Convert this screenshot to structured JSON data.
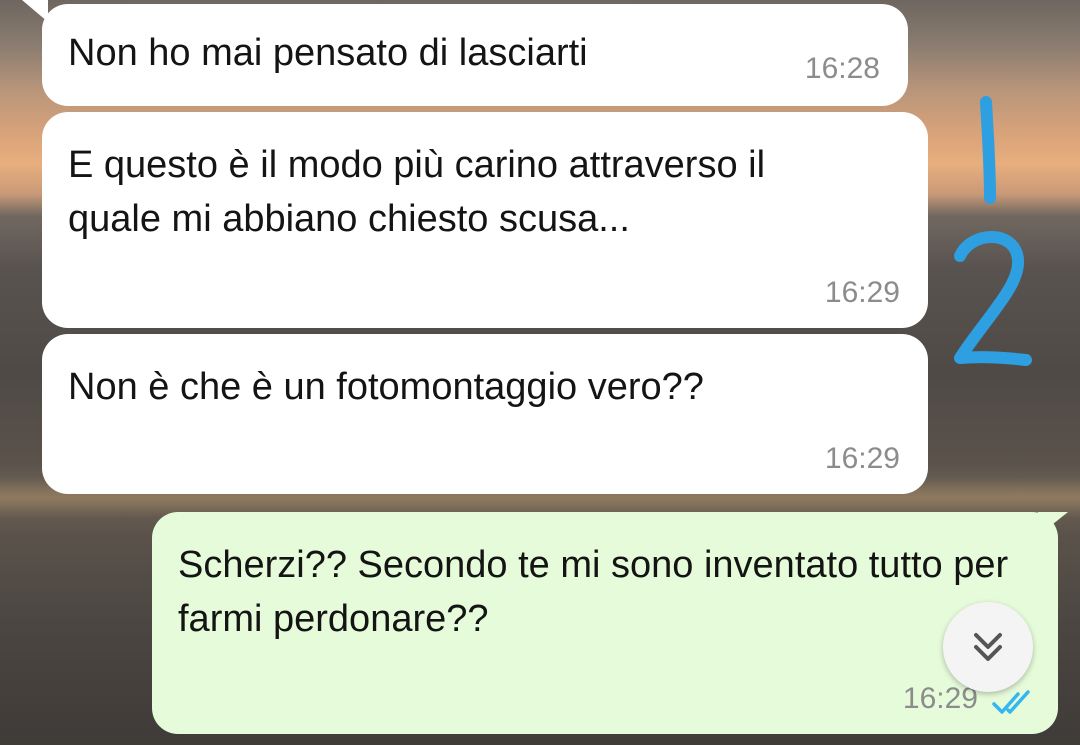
{
  "messages": [
    {
      "direction": "incoming",
      "text": "Non ho mai pensato di lasciarti",
      "time": "16:28"
    },
    {
      "direction": "incoming",
      "text": "E questo è il modo più carino attraverso il quale mi abbiano chiesto scusa...",
      "time": "16:29"
    },
    {
      "direction": "incoming",
      "text": "Non è che è un fotomontaggio vero??",
      "time": "16:29"
    },
    {
      "direction": "outgoing",
      "text": "Scherzi?? Secondo te mi sono inventato tutto per farmi perdonare??",
      "time": "16:29",
      "status": "read"
    }
  ],
  "annotations": [
    {
      "label": "1",
      "color": "#2e9fe0"
    },
    {
      "label": "2",
      "color": "#2e9fe0"
    }
  ],
  "colors": {
    "incoming_bubble": "#ffffff",
    "outgoing_bubble": "#e5fbd9",
    "timestamp": "#8c8c8c",
    "read_ticks": "#34b7f1"
  },
  "icons": {
    "scroll_down": "double-chevron-down-icon",
    "status": "double-check-icon"
  }
}
